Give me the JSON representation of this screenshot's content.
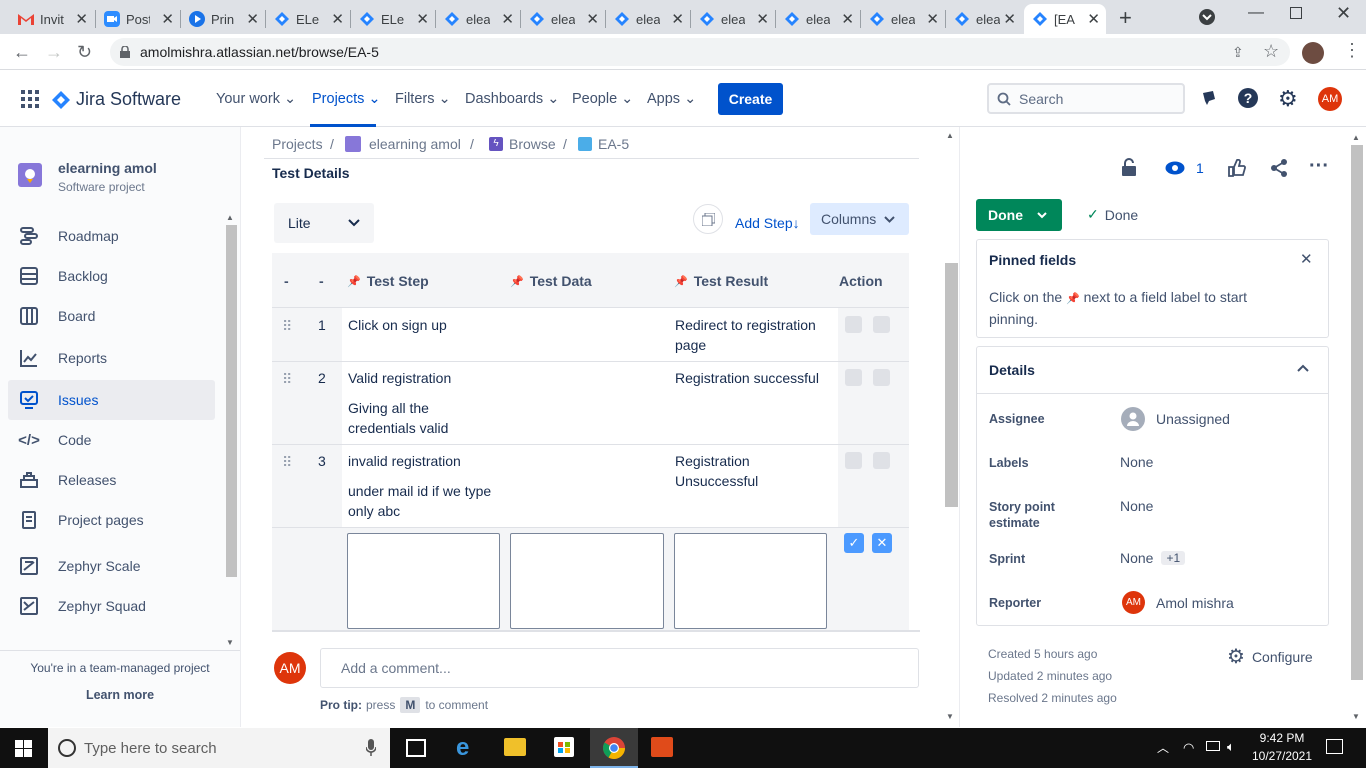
{
  "browser": {
    "tabs": [
      {
        "label": "Invit"
      },
      {
        "label": "Post"
      },
      {
        "label": "Prin"
      },
      {
        "label": "ELe"
      },
      {
        "label": "ELe"
      },
      {
        "label": "elea"
      },
      {
        "label": "elea"
      },
      {
        "label": "elea"
      },
      {
        "label": "elea"
      },
      {
        "label": "elea"
      },
      {
        "label": "elea"
      },
      {
        "label": "elea"
      },
      {
        "label": "[EA"
      }
    ],
    "url": "amolmishra.atlassian.net/browse/EA-5"
  },
  "header": {
    "product": "Jira Software",
    "nav": [
      "Your work",
      "Projects",
      "Filters",
      "Dashboards",
      "People",
      "Apps"
    ],
    "create": "Create",
    "search_placeholder": "Search",
    "avatar": "AM"
  },
  "sidebar": {
    "project_name": "elearning amol",
    "project_type": "Software project",
    "items": [
      "Roadmap",
      "Backlog",
      "Board",
      "Reports",
      "Issues",
      "Code",
      "Releases",
      "Project pages",
      "Zephyr Scale",
      "Zephyr Squad"
    ],
    "footer_text": "You're in a team-managed project",
    "learn_more": "Learn more"
  },
  "breadcrumb": [
    "Projects",
    "elearning amol",
    "Browse",
    "EA-5"
  ],
  "test_details": {
    "title": "Test Details",
    "mode": "Lite",
    "add_step": "Add Step",
    "columns": "Columns",
    "headers": [
      "-",
      "-",
      "Test Step",
      "Test Data",
      "Test Result",
      "Action"
    ],
    "rows": [
      {
        "num": "1",
        "step": "Click on sign up",
        "data": "",
        "result": "Redirect to registration page"
      },
      {
        "num": "2",
        "step": "Valid registration",
        "data": "Giving all the credentials valid",
        "result": "Registration successful"
      },
      {
        "num": "3",
        "step": "invalid registration",
        "data": "under mail id if we type only abc",
        "result": "Registration Unsuccessful"
      }
    ]
  },
  "comment": {
    "avatar": "AM",
    "placeholder": "Add a comment...",
    "pro_tip": "Pro tip:",
    "press": "press",
    "key": "M",
    "to_comment": "to comment"
  },
  "issue_panel": {
    "watch_count": "1",
    "status_button": "Done",
    "resolution": "Done",
    "pinned_title": "Pinned fields",
    "pinned_text_1": "Click on the",
    "pinned_text_2": "next to a field label to start pinning.",
    "details_title": "Details",
    "fields": [
      {
        "label": "Assignee",
        "value": "Unassigned"
      },
      {
        "label": "Labels",
        "value": "None"
      },
      {
        "label": "Story point estimate",
        "value": "None"
      },
      {
        "label": "Sprint",
        "value": "None",
        "extra": "+1"
      },
      {
        "label": "Reporter",
        "value": "Amol mishra",
        "avatar": "AM"
      }
    ],
    "created": "Created 5 hours ago",
    "updated": "Updated 2 minutes ago",
    "resolved": "Resolved 2 minutes ago",
    "configure": "Configure"
  },
  "taskbar": {
    "search_placeholder": "Type here to search",
    "time": "9:42 PM",
    "date": "10/27/2021"
  },
  "colors": {
    "primary": "#0052CC",
    "done_green": "#00875A",
    "avatar_red": "#DE350B"
  }
}
